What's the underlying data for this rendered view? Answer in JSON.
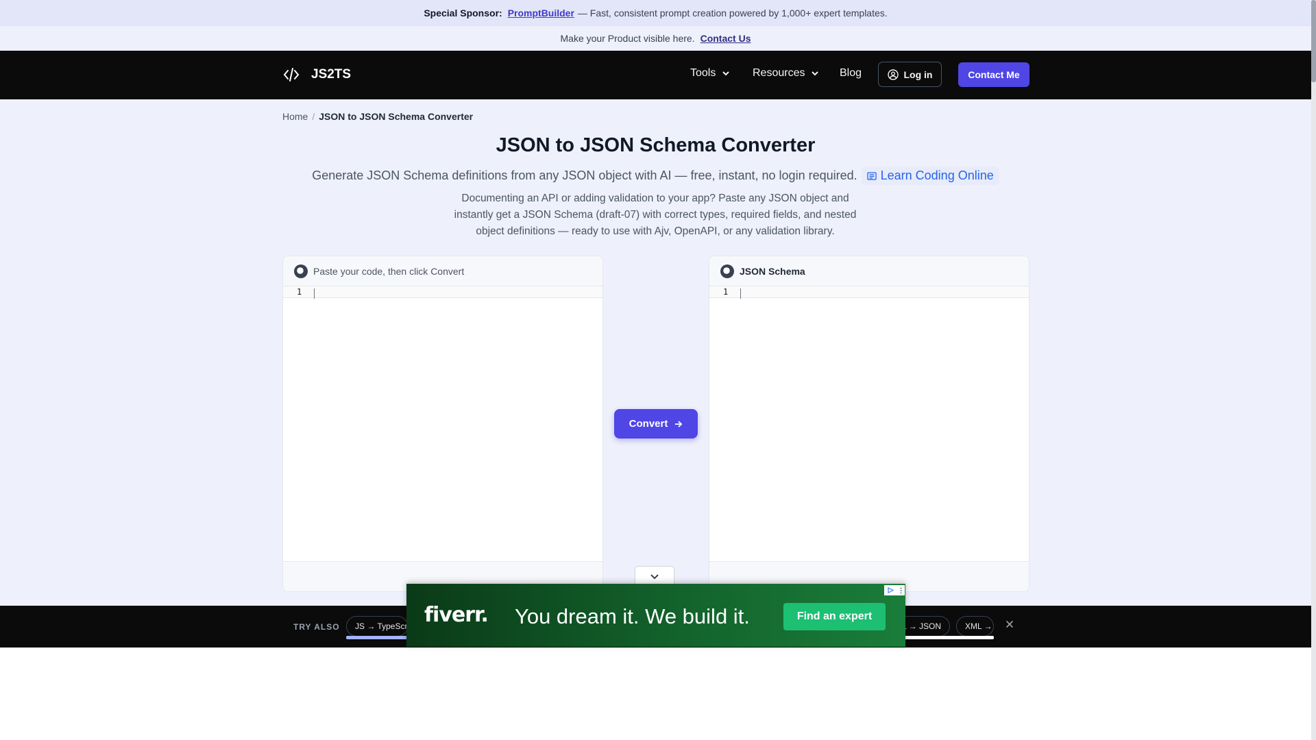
{
  "sponsor": {
    "label": "Special Sponsor:",
    "link": "PromptBuilder",
    "text": "— Fast, consistent prompt creation powered by 1,000+ expert templates."
  },
  "promo": {
    "text": "Make your Product visible here.",
    "link": "Contact Us"
  },
  "nav": {
    "brand": "JS2TS",
    "tools": "Tools",
    "resources": "Resources",
    "blog": "Blog",
    "login": "Log in",
    "contact": "Contact Me"
  },
  "breadcrumb": {
    "home": "Home",
    "separator": "/",
    "current": "JSON to JSON Schema Converter"
  },
  "hero": {
    "title": "JSON to JSON Schema Converter",
    "subtitle": "Generate JSON Schema definitions from any JSON object with AI — free, instant, no login required.",
    "learn_link": "Learn Coding Online",
    "description": "Documenting an API or adding validation to your app? Paste any JSON object and instantly get a JSON Schema (draft-07) with correct types, required fields, and nested object definitions — ready to use with Ajv, OpenAPI, or any validation library."
  },
  "input_panel": {
    "header": "Paste your code, then click Convert",
    "line_number": "1"
  },
  "output_panel": {
    "header": "JSON Schema",
    "line_number": "1"
  },
  "convert_button": "Convert",
  "try_also": {
    "label": "TRY ALSO",
    "chips": [
      "JS → TypeScr",
      "L → JSON",
      "XML →"
    ]
  },
  "ad": {
    "logo": "fiverr.",
    "tagline": "You dream it. We build it.",
    "button": "Find an expert"
  },
  "colors": {
    "accent": "#4f46e5",
    "navbar": "#0b0b0c",
    "page_bg": "#eef0fb",
    "ad_green": "#1dbf73"
  },
  "icons": [
    "code-icon",
    "chevron-down-icon",
    "user-circle-icon",
    "book-icon",
    "arrow-right-icon",
    "close-icon"
  ]
}
